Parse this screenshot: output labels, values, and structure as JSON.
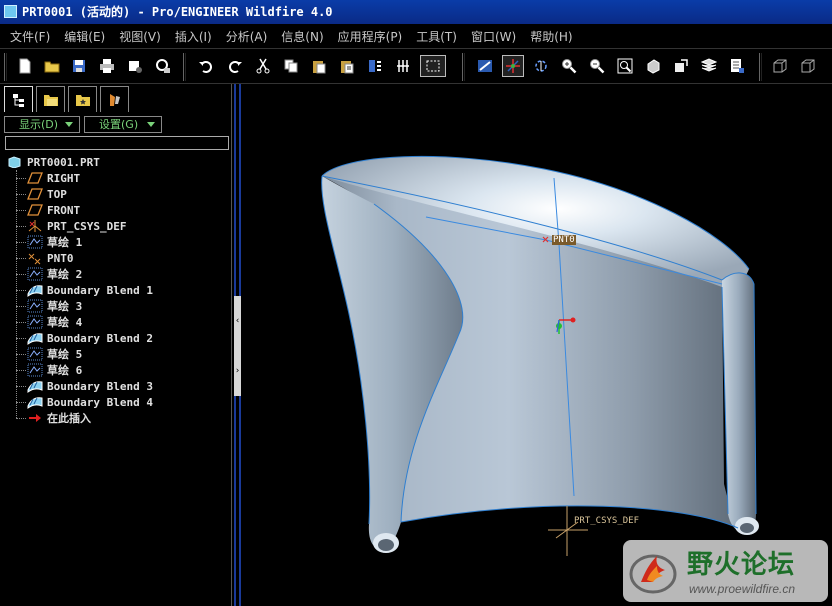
{
  "window": {
    "title": "PRT0001 (活动的) - Pro/ENGINEER Wildfire 4.0"
  },
  "menubar": {
    "items": [
      {
        "label": "文件(F)"
      },
      {
        "label": "编辑(E)"
      },
      {
        "label": "视图(V)"
      },
      {
        "label": "插入(I)"
      },
      {
        "label": "分析(A)"
      },
      {
        "label": "信息(N)"
      },
      {
        "label": "应用程序(P)"
      },
      {
        "label": "工具(T)"
      },
      {
        "label": "窗口(W)"
      },
      {
        "label": "帮助(H)"
      }
    ]
  },
  "toolbar": {
    "buttons": [
      {
        "icon": "new-file-icon"
      },
      {
        "icon": "open-folder-icon"
      },
      {
        "icon": "save-icon"
      },
      {
        "icon": "print-icon"
      },
      {
        "icon": "send-mail-icon"
      },
      {
        "icon": "copy-view-icon"
      },
      {
        "icon": "undo-icon"
      },
      {
        "icon": "redo-icon"
      },
      {
        "icon": "cut-icon"
      },
      {
        "icon": "copy-icon"
      },
      {
        "icon": "paste-icon"
      },
      {
        "icon": "paste-special-icon"
      },
      {
        "icon": "regenerate-icon"
      },
      {
        "icon": "relations-icon"
      },
      {
        "icon": "select-box-icon"
      },
      {
        "icon": "repaint-icon"
      },
      {
        "icon": "spin-center-icon"
      },
      {
        "icon": "orient-mode-icon"
      },
      {
        "icon": "zoom-in-icon"
      },
      {
        "icon": "zoom-out-icon"
      },
      {
        "icon": "refit-icon"
      },
      {
        "icon": "reorient-icon"
      },
      {
        "icon": "saved-views-icon"
      },
      {
        "icon": "layers-icon"
      },
      {
        "icon": "view-manager-icon"
      },
      {
        "icon": "wireframe-icon"
      },
      {
        "icon": "hidden-line-icon"
      }
    ]
  },
  "leftpanel": {
    "tabs": [
      {
        "icon": "model-tree-icon",
        "active": true
      },
      {
        "icon": "folder-browser-icon",
        "active": false
      },
      {
        "icon": "favorites-icon",
        "active": false
      },
      {
        "icon": "connections-icon",
        "active": false
      }
    ],
    "display_dropdown": "显示(D)",
    "settings_dropdown": "设置(G)",
    "model_tree": {
      "root": "PRT0001.PRT",
      "items": [
        {
          "label": "RIGHT",
          "icon": "datum-plane-icon"
        },
        {
          "label": "TOP",
          "icon": "datum-plane-icon"
        },
        {
          "label": "FRONT",
          "icon": "datum-plane-icon"
        },
        {
          "label": "PRT_CSYS_DEF",
          "icon": "coordinate-system-icon"
        },
        {
          "label": "草绘 1",
          "icon": "sketch-icon"
        },
        {
          "label": "PNT0",
          "icon": "datum-point-icon"
        },
        {
          "label": "草绘 2",
          "icon": "sketch-icon"
        },
        {
          "label": "Boundary Blend 1",
          "icon": "boundary-blend-icon"
        },
        {
          "label": "草绘 3",
          "icon": "sketch-icon"
        },
        {
          "label": "草绘 4",
          "icon": "sketch-icon"
        },
        {
          "label": "Boundary Blend 2",
          "icon": "boundary-blend-icon"
        },
        {
          "label": "草绘 5",
          "icon": "sketch-icon"
        },
        {
          "label": "草绘 6",
          "icon": "sketch-icon"
        },
        {
          "label": "Boundary Blend 3",
          "icon": "boundary-blend-icon"
        },
        {
          "label": "Boundary Blend 4",
          "icon": "boundary-blend-icon"
        },
        {
          "label": "在此插入",
          "icon": "insert-here-arrow-icon"
        }
      ]
    }
  },
  "graphics": {
    "point_label": "PNT0",
    "csys_label": "PRT_CSYS_DEF",
    "colors": {
      "background": "#000000",
      "surface": "#b9c7d6",
      "edge": "#2f7fd0",
      "datum": "#c9a26a"
    }
  },
  "watermark": {
    "title": "野火论坛",
    "url": "www.proewildfire.cn"
  }
}
